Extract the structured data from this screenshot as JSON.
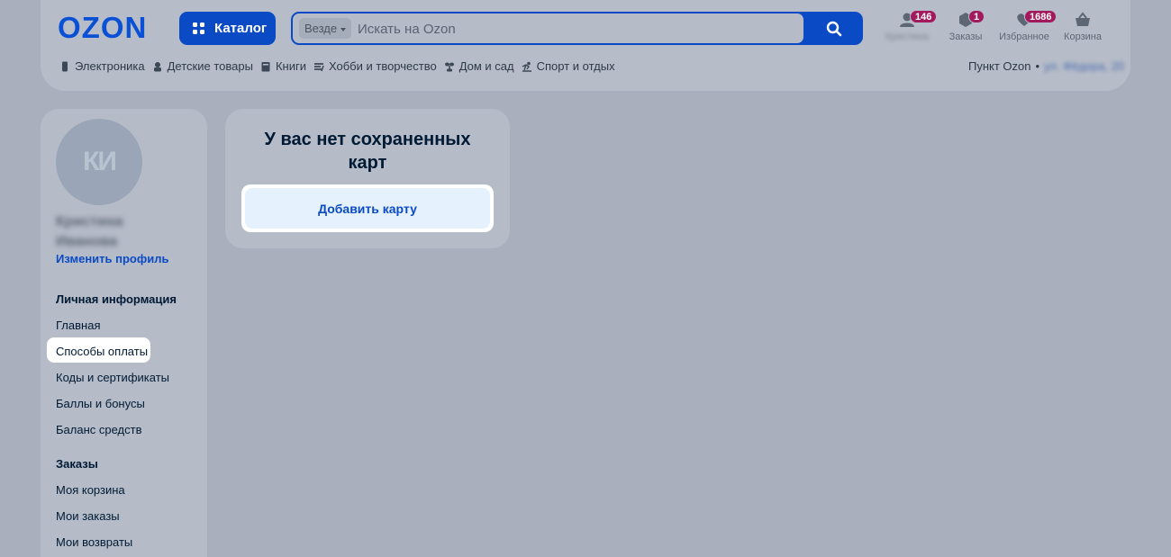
{
  "header": {
    "logo": "OZON",
    "catalog_label": "Каталог",
    "search": {
      "scope_label": "Везде",
      "placeholder": "Искать на Ozon"
    },
    "icons": [
      {
        "name": "profile",
        "label": "Кристина",
        "badge": "146"
      },
      {
        "name": "orders",
        "label": "Заказы",
        "badge": "1"
      },
      {
        "name": "favorites",
        "label": "Избранное",
        "badge": "1686"
      },
      {
        "name": "cart",
        "label": "Корзина",
        "badge": ""
      }
    ],
    "categories": [
      {
        "icon": "phone-icon",
        "label": "Электроника"
      },
      {
        "icon": "toy-icon",
        "label": "Детские товары"
      },
      {
        "icon": "book-icon",
        "label": "Книги"
      },
      {
        "icon": "hobby-icon",
        "label": "Хобби и творчество"
      },
      {
        "icon": "plant-icon",
        "label": "Дом и сад"
      },
      {
        "icon": "sport-icon",
        "label": "Спорт и отдых"
      }
    ],
    "pickup_label": "Пункт Ozon",
    "pickup_address": "ул. Фёдора, 20"
  },
  "sidebar": {
    "avatar_initials": "КИ",
    "user_name_line1": "Кристина",
    "user_name_line2": "Иванова",
    "edit_profile": "Изменить профиль",
    "section_personal": "Личная информация",
    "personal_items": [
      "Главная",
      "Способы оплаты",
      "Коды и сертификаты",
      "Баллы и бонусы",
      "Баланс средств"
    ],
    "section_orders": "Заказы",
    "order_items": [
      "Моя корзина",
      "Мои заказы",
      "Мои возвраты"
    ]
  },
  "main": {
    "empty_title": "У вас нет сохраненных карт",
    "add_card_label": "Добавить карту"
  },
  "colors": {
    "brand": "#0a4bc5",
    "badge": "#a3195e",
    "overlay_bg": "#a9afbd"
  }
}
